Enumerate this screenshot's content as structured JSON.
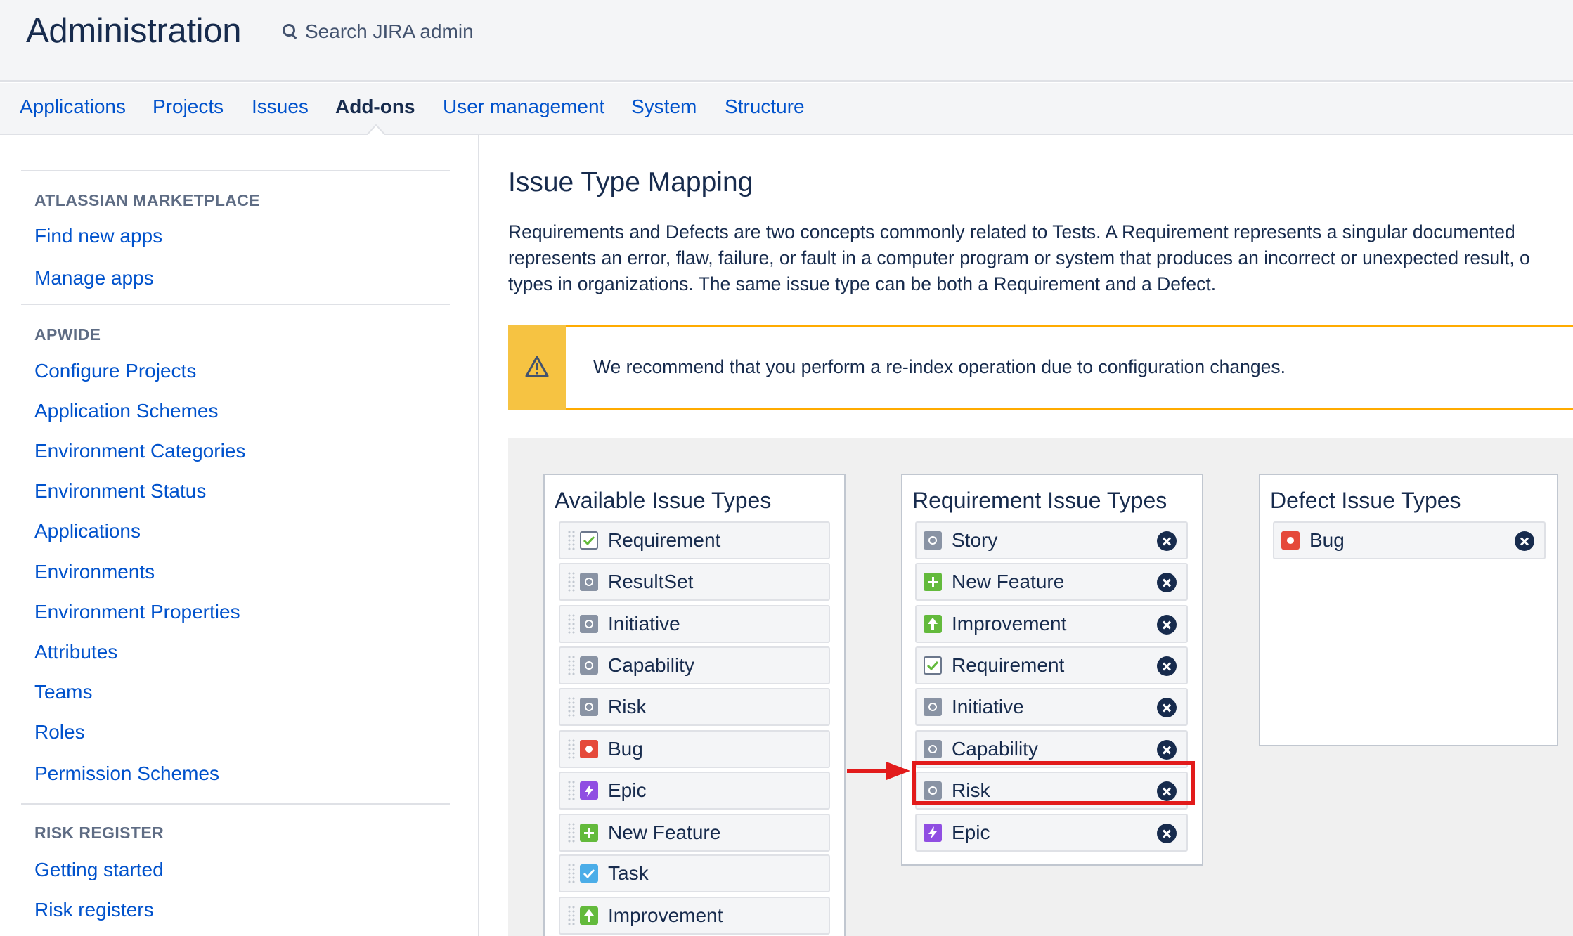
{
  "header": {
    "title": "Administration",
    "search_placeholder": "Search JIRA admin"
  },
  "nav": {
    "tabs": [
      {
        "label": "Applications",
        "active": false
      },
      {
        "label": "Projects",
        "active": false
      },
      {
        "label": "Issues",
        "active": false
      },
      {
        "label": "Add-ons",
        "active": true
      },
      {
        "label": "User management",
        "active": false
      },
      {
        "label": "System",
        "active": false
      },
      {
        "label": "Structure",
        "active": false
      }
    ]
  },
  "sidebar": {
    "sections": [
      {
        "heading": "ATLASSIAN MARKETPLACE",
        "links": [
          "Find new apps",
          "Manage apps"
        ]
      },
      {
        "heading": "APWIDE",
        "links": [
          "Configure Projects",
          "Application Schemes",
          "Environment Categories",
          "Environment Status",
          "Applications",
          "Environments",
          "Environment Properties",
          "Attributes",
          "Teams",
          "Roles",
          "Permission Schemes"
        ]
      },
      {
        "heading": "RISK REGISTER",
        "links": [
          "Getting started",
          "Risk registers"
        ]
      }
    ]
  },
  "main": {
    "title": "Issue Type Mapping",
    "description_lines": [
      "Requirements and Defects are two concepts commonly related to Tests. A Requirement represents a singular documented",
      "represents an error, flaw, failure, or fault in a computer program or system that produces an incorrect or unexpected result, o",
      "types in organizations. The same issue type can be both a Requirement and a Defect."
    ],
    "warning": "We recommend that you perform a re-index operation due to configuration changes."
  },
  "panels": {
    "available": {
      "title": "Available Issue Types",
      "items": [
        {
          "label": "Requirement",
          "icon": "requirement-icon"
        },
        {
          "label": "ResultSet",
          "icon": "gray-issue-icon"
        },
        {
          "label": "Initiative",
          "icon": "gray-issue-icon"
        },
        {
          "label": "Capability",
          "icon": "gray-issue-icon"
        },
        {
          "label": "Risk",
          "icon": "gray-issue-icon"
        },
        {
          "label": "Bug",
          "icon": "bug-icon"
        },
        {
          "label": "Epic",
          "icon": "epic-icon"
        },
        {
          "label": "New Feature",
          "icon": "new-feature-icon"
        },
        {
          "label": "Task",
          "icon": "task-icon"
        },
        {
          "label": "Improvement",
          "icon": "improvement-icon"
        }
      ]
    },
    "requirement": {
      "title": "Requirement Issue Types",
      "items": [
        {
          "label": "Story",
          "icon": "gray-issue-icon"
        },
        {
          "label": "New Feature",
          "icon": "new-feature-icon"
        },
        {
          "label": "Improvement",
          "icon": "improvement-icon"
        },
        {
          "label": "Requirement",
          "icon": "requirement-icon"
        },
        {
          "label": "Initiative",
          "icon": "gray-issue-icon"
        },
        {
          "label": "Capability",
          "icon": "gray-issue-icon"
        },
        {
          "label": "Risk",
          "icon": "gray-issue-icon"
        },
        {
          "label": "Epic",
          "icon": "epic-icon"
        }
      ]
    },
    "defect": {
      "title": "Defect Issue Types",
      "items": [
        {
          "label": "Bug",
          "icon": "bug-icon"
        }
      ]
    }
  },
  "colors": {
    "link": "#0052cc",
    "warning_bar": "#f6c342",
    "warning_border": "#ffab00",
    "highlight": "#e21b1b",
    "bug": "#e5493a",
    "epic": "#904ee2",
    "green": "#63ba3c",
    "task": "#4bade8"
  }
}
